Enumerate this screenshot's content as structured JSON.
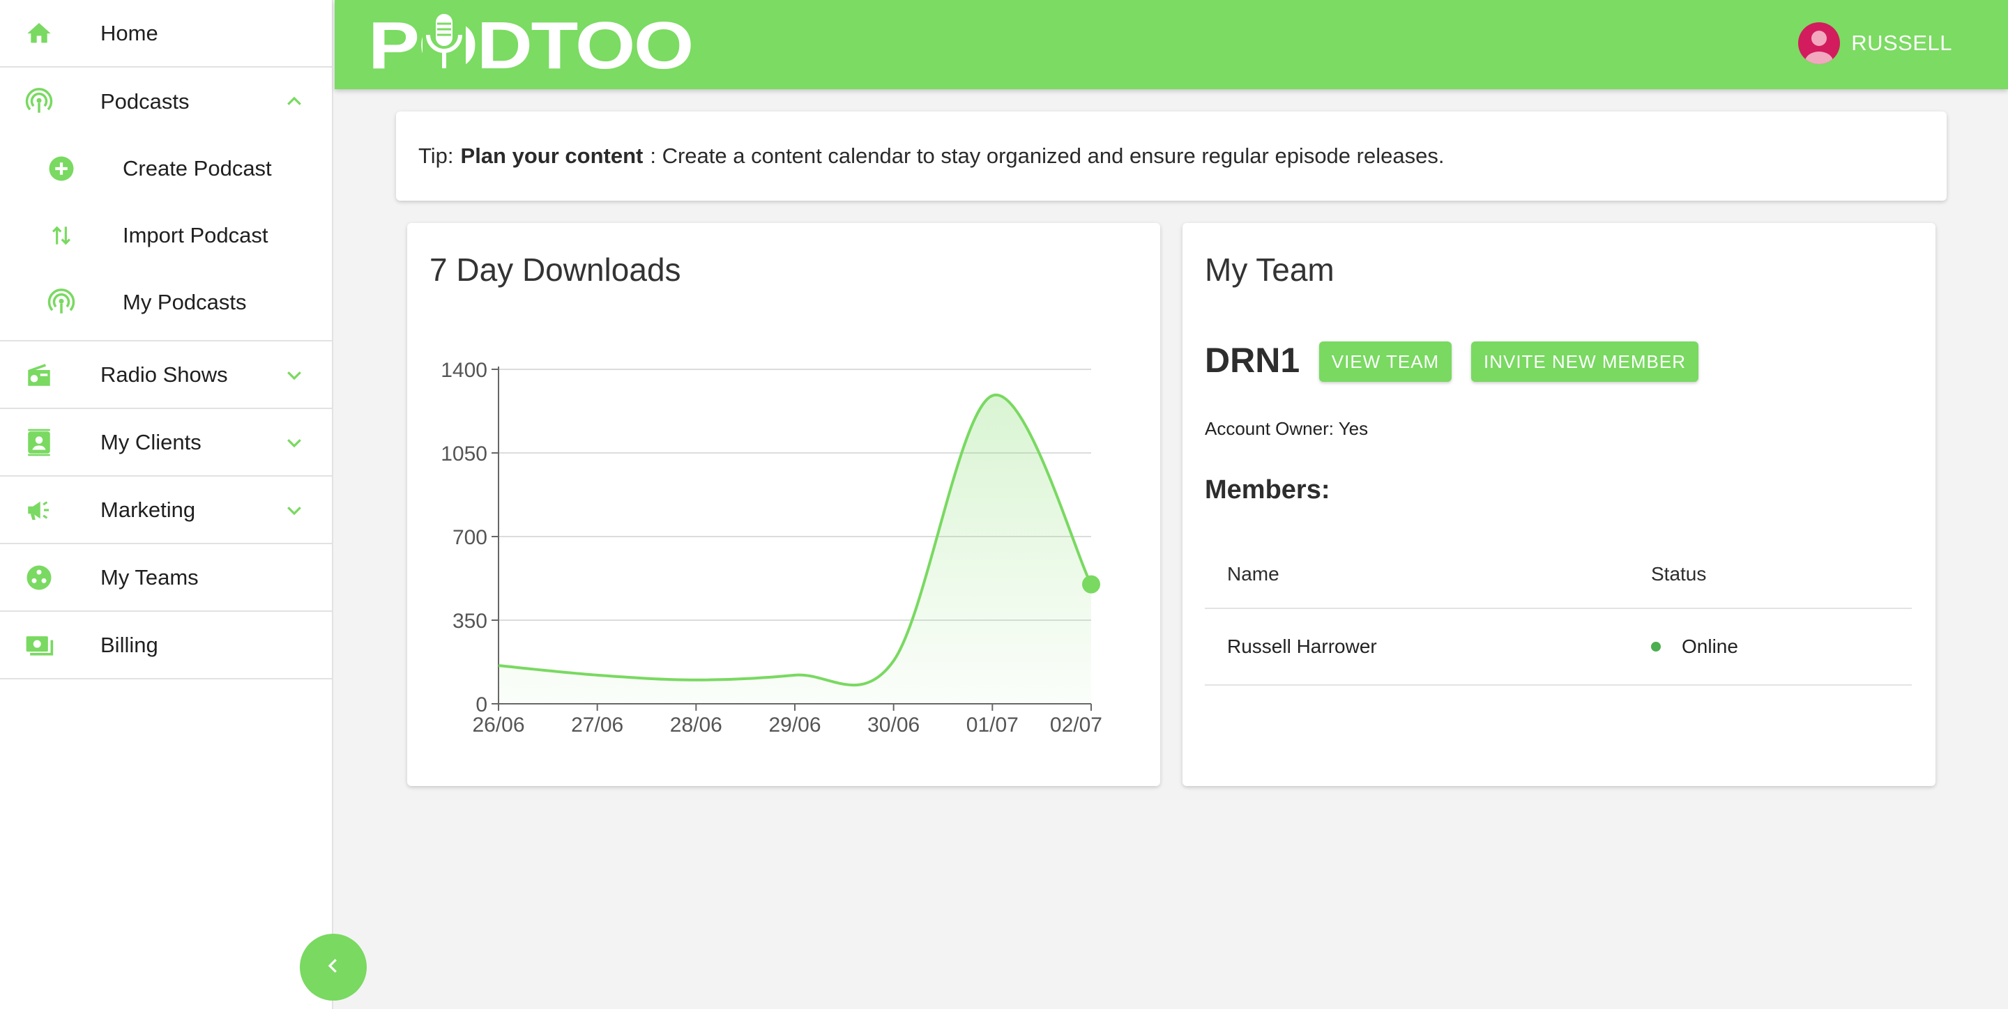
{
  "sidebar": {
    "items": [
      {
        "label": "Home",
        "icon": "home-icon"
      },
      {
        "label": "Podcasts",
        "icon": "podcast-icon",
        "expanded": true,
        "children": [
          {
            "label": "Create Podcast",
            "icon": "add-circle-icon"
          },
          {
            "label": "Import Podcast",
            "icon": "import-arrows-icon"
          },
          {
            "label": "My Podcasts",
            "icon": "podcast-icon"
          }
        ]
      },
      {
        "label": "Radio Shows",
        "icon": "radio-icon"
      },
      {
        "label": "My Clients",
        "icon": "contact-card-icon"
      },
      {
        "label": "Marketing",
        "icon": "megaphone-icon"
      },
      {
        "label": "My Teams",
        "icon": "team-icon"
      },
      {
        "label": "Billing",
        "icon": "money-icon"
      }
    ]
  },
  "header": {
    "logo_text": "PODTOO",
    "user_name": "RUSSELL"
  },
  "tip": {
    "prefix": "Tip:",
    "bold": "Plan your content",
    "text": ": Create a content calendar to stay organized and ensure regular episode releases."
  },
  "downloads": {
    "title": "7 Day Downloads"
  },
  "chart_data": {
    "type": "area",
    "categories": [
      "26/06",
      "27/06",
      "28/06",
      "29/06",
      "30/06",
      "01/07",
      "02/07"
    ],
    "values": [
      160,
      120,
      100,
      120,
      180,
      1290,
      500
    ],
    "yticks": [
      0,
      350,
      700,
      1050,
      1400
    ],
    "ylim": [
      0,
      1400
    ],
    "grid": true,
    "color": "#79d961"
  },
  "team": {
    "title": "My Team",
    "name": "DRN1",
    "view_button": "VIEW TEAM",
    "invite_button": "INVITE NEW MEMBER",
    "owner_text": "Account Owner: Yes",
    "members_title": "Members:",
    "columns": [
      "Name",
      "Status"
    ],
    "members": [
      {
        "name": "Russell Harrower",
        "status": "Online"
      }
    ]
  },
  "colors": {
    "accent": "#7bdb62",
    "online": "#4caf50",
    "avatar": "#d21c5e"
  }
}
